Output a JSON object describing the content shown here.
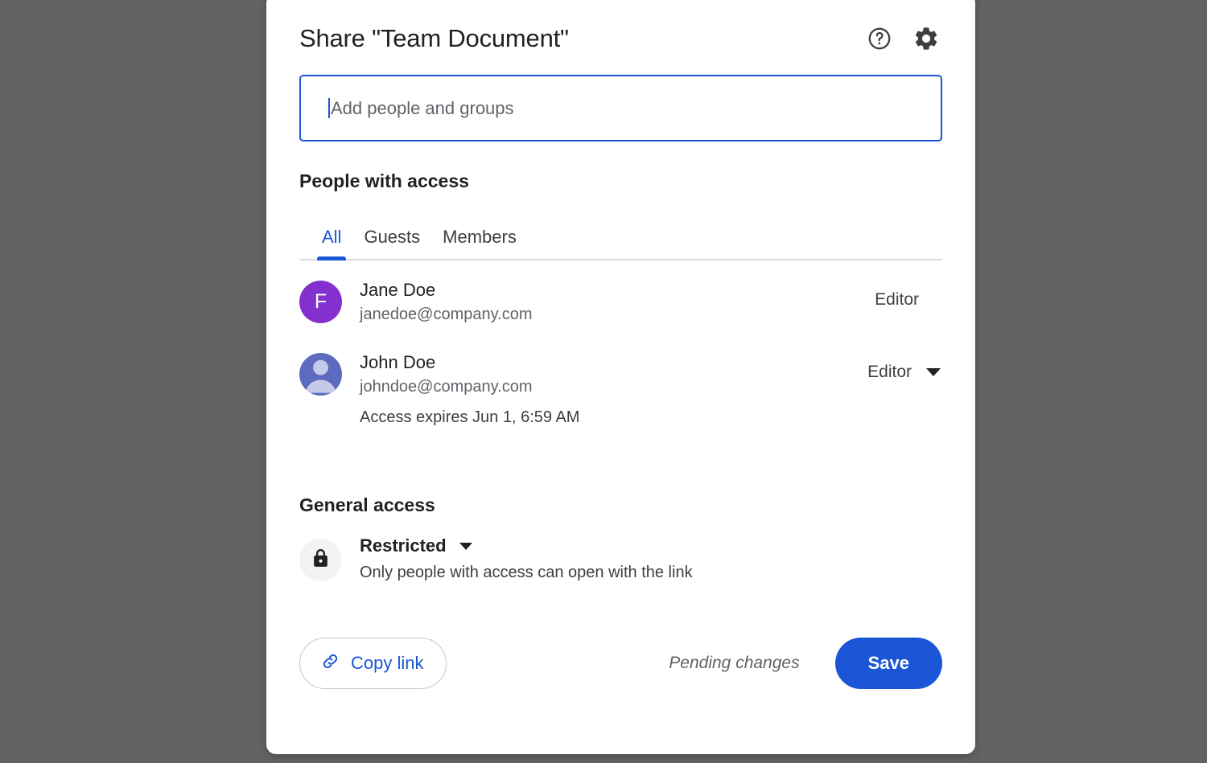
{
  "dialog": {
    "title": "Share \"Team Document\"",
    "help_icon": "help-circle-icon",
    "settings_icon": "gear-icon"
  },
  "add_field": {
    "placeholder": "Add people and groups",
    "value": ""
  },
  "people_section": {
    "heading": "People with access",
    "tabs": [
      {
        "label": "All",
        "active": true
      },
      {
        "label": "Guests",
        "active": false
      },
      {
        "label": "Members",
        "active": false
      }
    ],
    "people": [
      {
        "name": "Jane Doe",
        "email": "janedoe@company.com",
        "role": "Editor",
        "avatar_initial": "F",
        "avatar_color": "#8430ce",
        "has_role_dropdown": false,
        "expiry": ""
      },
      {
        "name": "John Doe",
        "email": "johndoe@company.com",
        "role": "Editor",
        "avatar_initial": "",
        "avatar_color": "#5c6bc0",
        "has_role_dropdown": true,
        "expiry": "Access expires Jun 1, 6:59 AM"
      }
    ]
  },
  "general_access": {
    "heading": "General access",
    "mode": "Restricted",
    "description": "Only people with access can open with the link",
    "icon": "lock-icon"
  },
  "footer": {
    "copy_link_label": "Copy link",
    "copy_link_icon": "link-icon",
    "status": "Pending changes",
    "save_label": "Save"
  },
  "colors": {
    "accent": "#1a56d6",
    "backdrop": "#636363",
    "surface": "#ffffff",
    "text_primary": "#202124",
    "text_secondary": "#5f6368"
  }
}
